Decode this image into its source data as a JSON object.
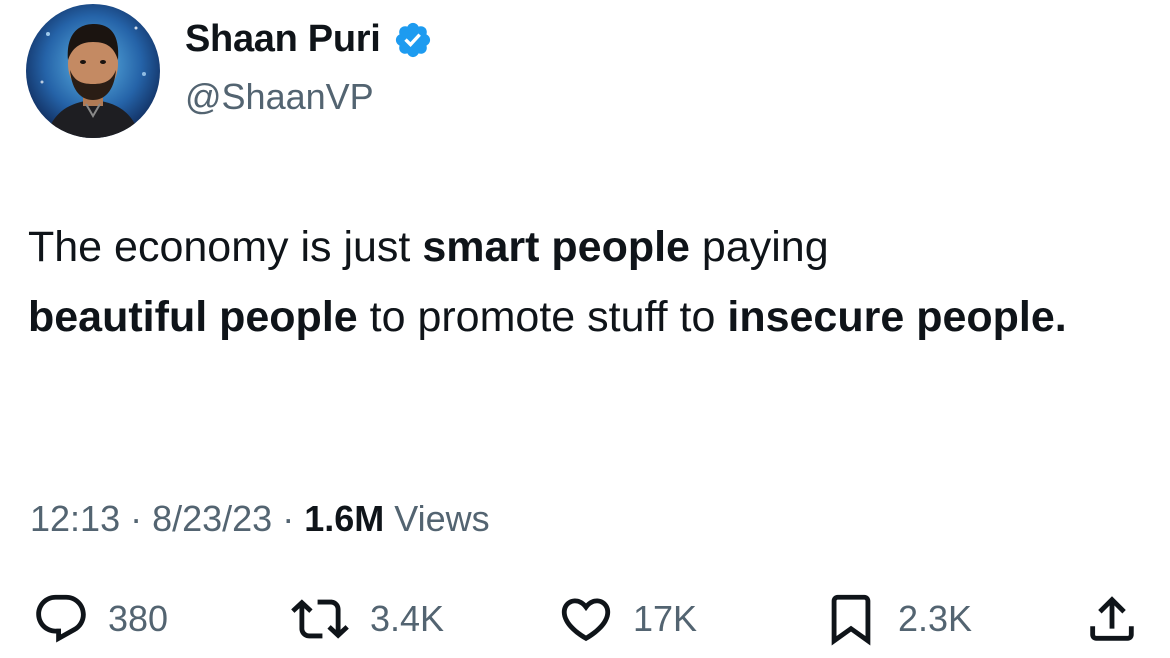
{
  "author": {
    "display_name": "Shaan Puri",
    "handle": "@ShaanVP",
    "verified": true,
    "verified_color": "#1d9bf0",
    "avatar_icon": "profile-photo"
  },
  "tweet": {
    "segments": [
      {
        "text": "The economy is just ",
        "bold": false
      },
      {
        "text": "smart people",
        "bold": true
      },
      {
        "text": " paying ",
        "bold": false
      },
      {
        "text": "beautiful people",
        "bold": true
      },
      {
        "text": " to promote stuff to ",
        "bold": false
      },
      {
        "text": "insecure people.",
        "bold": true
      }
    ]
  },
  "meta": {
    "time": "12:13",
    "separator": "·",
    "date": "8/23/23",
    "views_count": "1.6M",
    "views_label": "Views"
  },
  "actions": {
    "replies": {
      "icon": "reply-icon",
      "count": "380"
    },
    "retweets": {
      "icon": "retweet-icon",
      "count": "3.4K"
    },
    "likes": {
      "icon": "heart-icon",
      "count": "17K"
    },
    "bookmarks": {
      "icon": "bookmark-icon",
      "count": "2.3K"
    },
    "share": {
      "icon": "share-icon"
    }
  },
  "colors": {
    "text": "#0f1419",
    "secondary": "#536471",
    "accent": "#1d9bf0"
  }
}
